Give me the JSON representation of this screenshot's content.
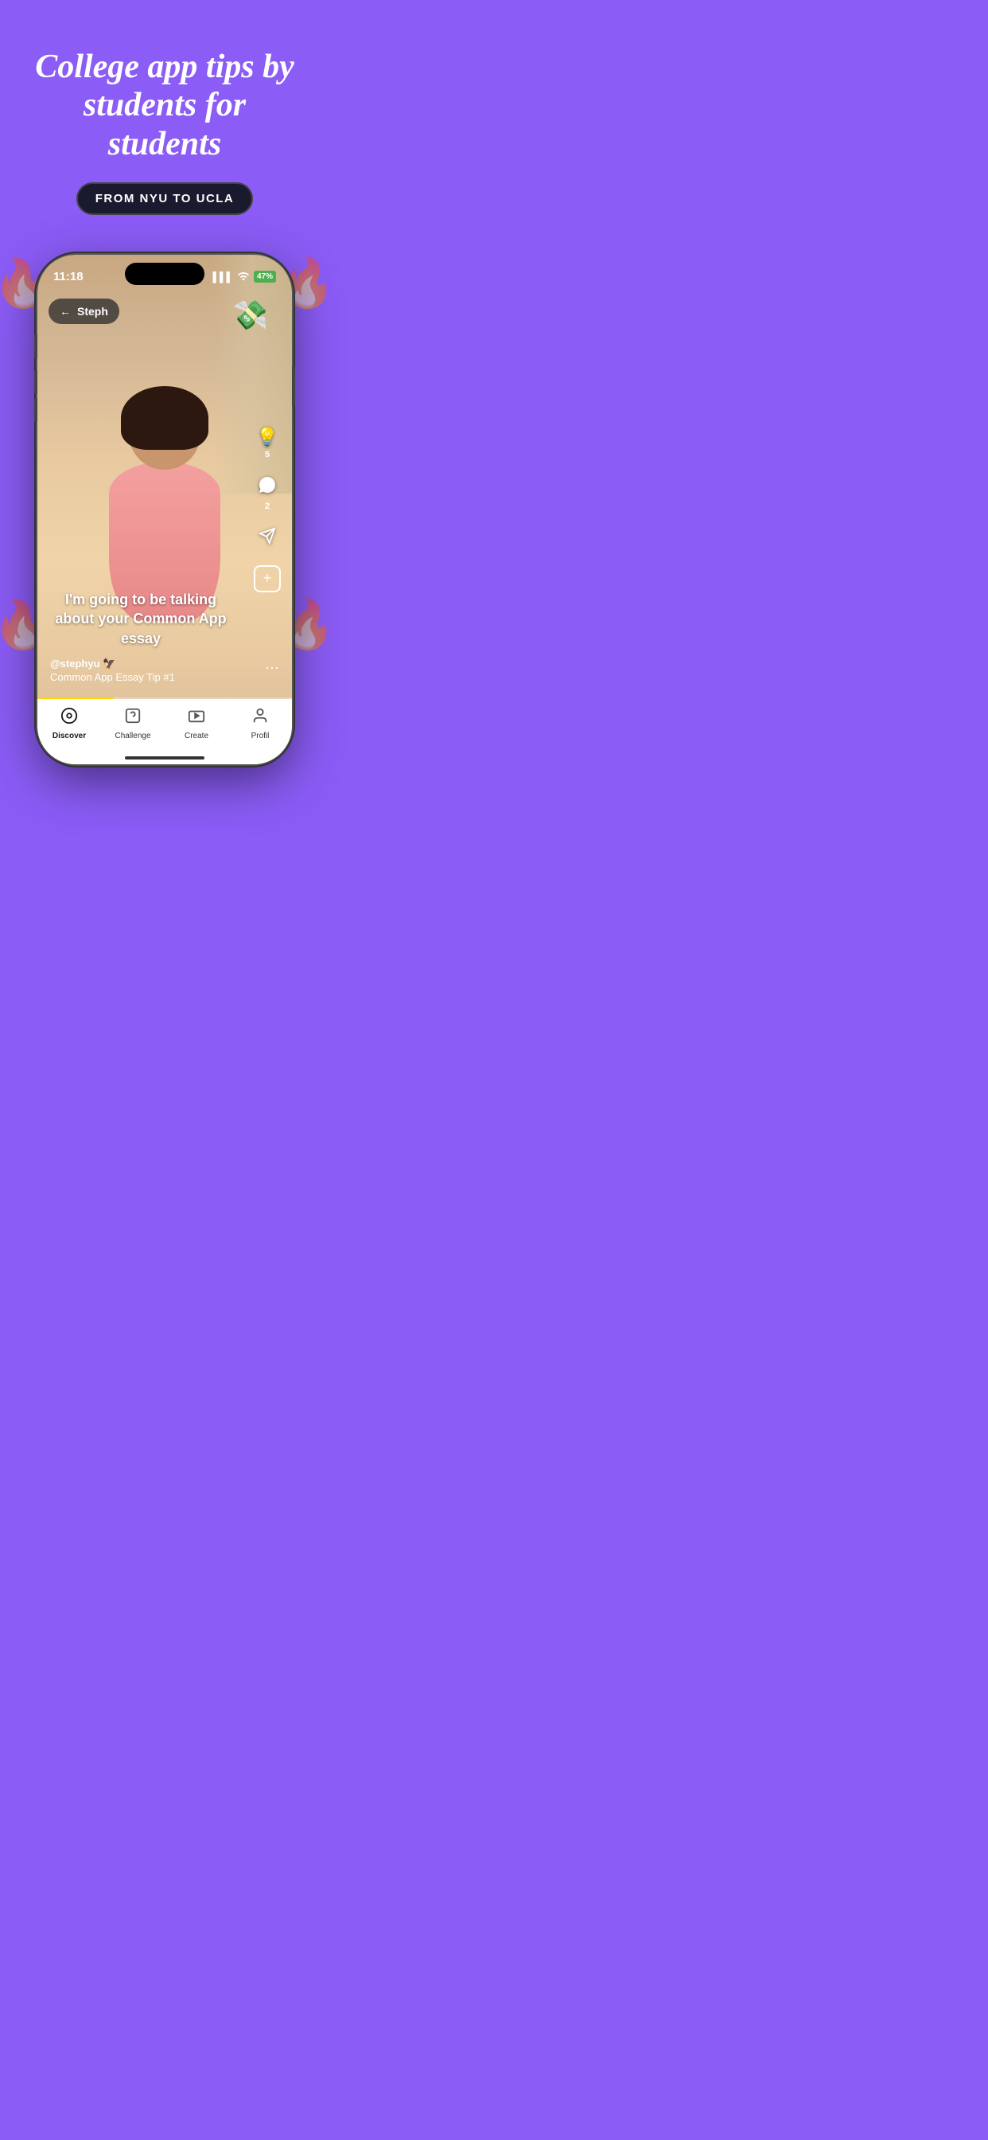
{
  "background": {
    "color": "#8B5CF6"
  },
  "header": {
    "headline": "College app tips by students for students",
    "tag_label": "FROM NYU TO UCLA"
  },
  "phone": {
    "status_bar": {
      "time": "11:18",
      "signal": "▌▌▌",
      "wifi": "WiFi",
      "battery": "47%"
    },
    "back_button": {
      "arrow": "←",
      "label": "Steph"
    },
    "money_emoji": "💸",
    "right_actions": [
      {
        "icon": "💡",
        "count": "5",
        "name": "tip-action"
      },
      {
        "icon": "💬",
        "count": "2",
        "name": "comment-action"
      },
      {
        "icon": "✉",
        "count": "",
        "name": "share-action"
      },
      {
        "icon": "+",
        "count": "",
        "name": "add-action"
      }
    ],
    "caption": {
      "main_text": "I'm going to be talking about your Common App essay",
      "username": "@stephyu 🦅",
      "video_title": "Common App Essay Tip #1"
    },
    "bottom_nav": [
      {
        "icon": "⊙",
        "label": "Discover",
        "active": true,
        "name": "nav-discover"
      },
      {
        "icon": "?",
        "label": "Challenge",
        "active": false,
        "name": "nav-challenge"
      },
      {
        "icon": "▶",
        "label": "Create",
        "active": false,
        "name": "nav-create"
      },
      {
        "icon": "👤",
        "label": "Profil",
        "active": false,
        "name": "nav-profil"
      }
    ]
  }
}
